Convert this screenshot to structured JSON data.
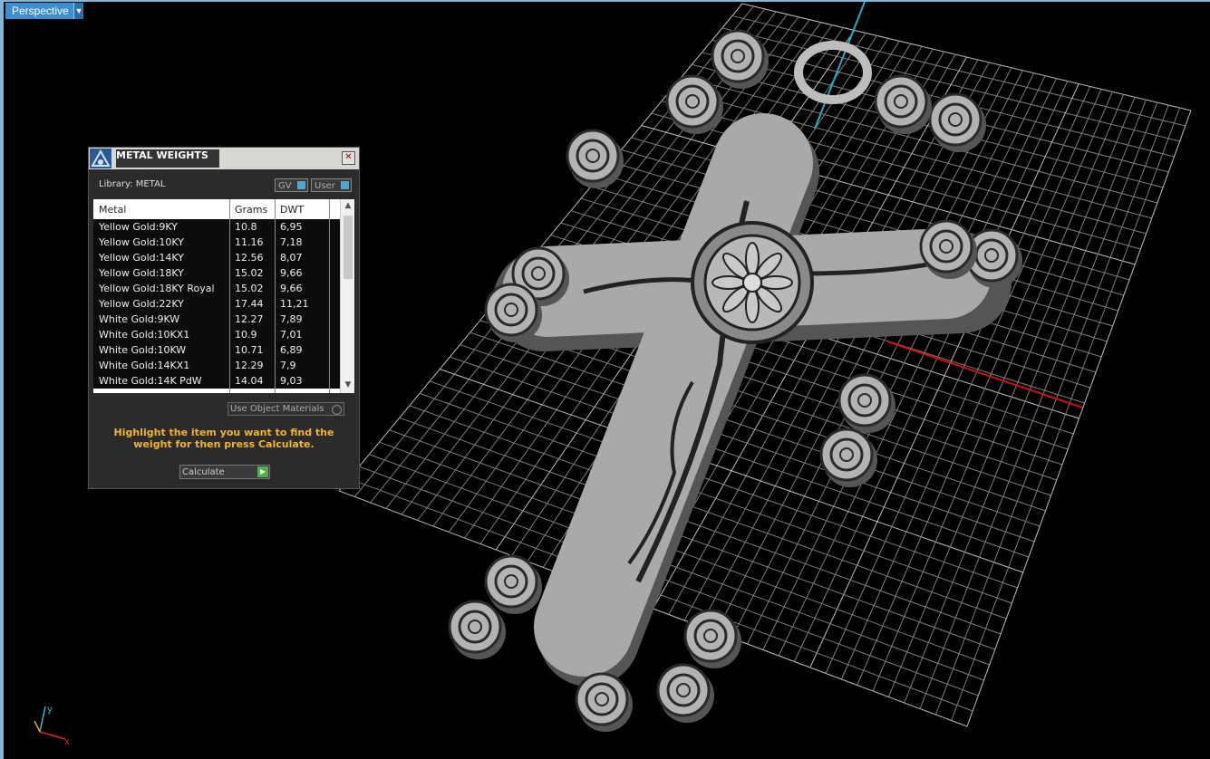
{
  "viewport": {
    "view_label": "Perspective"
  },
  "panel": {
    "title": "METAL WEIGHTS",
    "library_label": "Library: METAL",
    "toggles": {
      "gv": "GV",
      "user": "User"
    },
    "columns": [
      "Metal",
      "Grams",
      "DWT"
    ],
    "rows": [
      {
        "metal": "Yellow Gold:9KY",
        "grams": "10.8",
        "dwt": "6,95"
      },
      {
        "metal": "Yellow Gold:10KY",
        "grams": "11.16",
        "dwt": "7,18"
      },
      {
        "metal": "Yellow Gold:14KY",
        "grams": "12.56",
        "dwt": "8,07"
      },
      {
        "metal": "Yellow Gold:18KY",
        "grams": "15.02",
        "dwt": "9,66"
      },
      {
        "metal": "Yellow Gold:18KY Royal",
        "grams": "15.02",
        "dwt": "9,66"
      },
      {
        "metal": "Yellow Gold:22KY",
        "grams": "17.44",
        "dwt": "11,21"
      },
      {
        "metal": "White Gold:9KW",
        "grams": "12.27",
        "dwt": "7,89"
      },
      {
        "metal": "White Gold:10KX1",
        "grams": "10.9",
        "dwt": "7,01"
      },
      {
        "metal": "White Gold:10KW",
        "grams": "10.71",
        "dwt": "6,89"
      },
      {
        "metal": "White Gold:14KX1",
        "grams": "12.29",
        "dwt": "7,9"
      },
      {
        "metal": "White Gold:14K PdW",
        "grams": "14.04",
        "dwt": "9,03"
      }
    ],
    "use_object_materials": "Use Object Materials",
    "hint": "Highlight the item you want to find the weight for then press Calculate.",
    "calculate": "Calculate"
  },
  "axis": {
    "x": "x",
    "y": "y"
  }
}
